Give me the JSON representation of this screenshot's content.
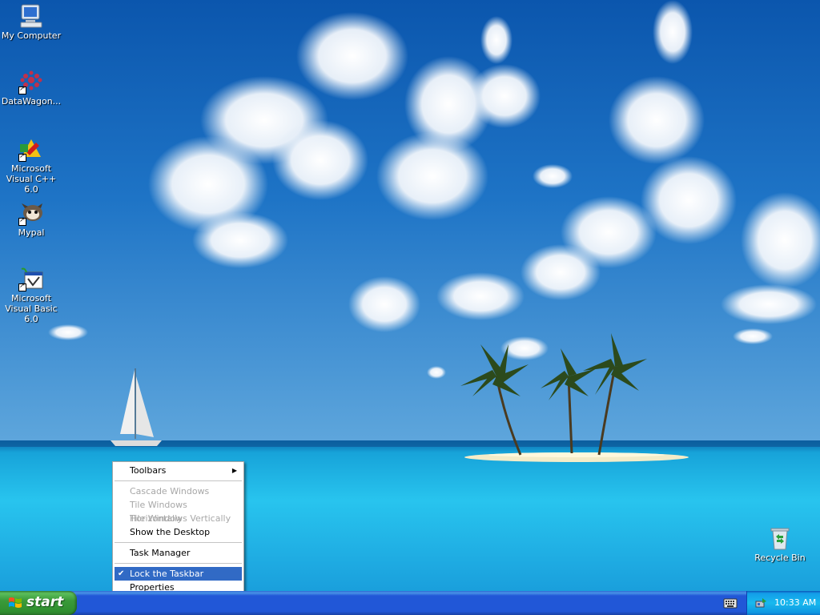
{
  "desktop": {
    "icons": [
      {
        "label": "My Computer",
        "icon": "my-computer-icon"
      },
      {
        "label": "DataWagon...",
        "icon": "datawagon-icon"
      },
      {
        "label": "Microsoft Visual C++ 6.0",
        "icon": "visual-cpp-icon"
      },
      {
        "label": "Mypal",
        "icon": "mypal-icon"
      },
      {
        "label": "Microsoft Visual Basic 6.0",
        "icon": "visual-basic-icon"
      },
      {
        "label": "Recycle Bin",
        "icon": "recycle-bin-icon"
      }
    ]
  },
  "context_menu": {
    "items": [
      {
        "label": "Toolbars",
        "enabled": true,
        "submenu": true
      },
      {
        "label": "Cascade Windows",
        "enabled": false
      },
      {
        "label": "Tile Windows Horizontally",
        "enabled": false
      },
      {
        "label": "Tile Windows Vertically",
        "enabled": false
      },
      {
        "label": "Show the Desktop",
        "enabled": true
      },
      {
        "label": "Task Manager",
        "enabled": true
      },
      {
        "label": "Lock the Taskbar",
        "enabled": true,
        "checked": true,
        "highlighted": true
      },
      {
        "label": "Properties",
        "enabled": true
      }
    ]
  },
  "taskbar": {
    "start_label": "start",
    "clock": "10:33 AM",
    "language_icon": "keyboard-icon",
    "tray_icon": "safely-remove-icon"
  },
  "colors": {
    "taskbar_blue": "#2157d7",
    "start_green": "#3a9a3a",
    "tray_blue": "#18b9ee",
    "menu_highlight": "#316ac5"
  }
}
